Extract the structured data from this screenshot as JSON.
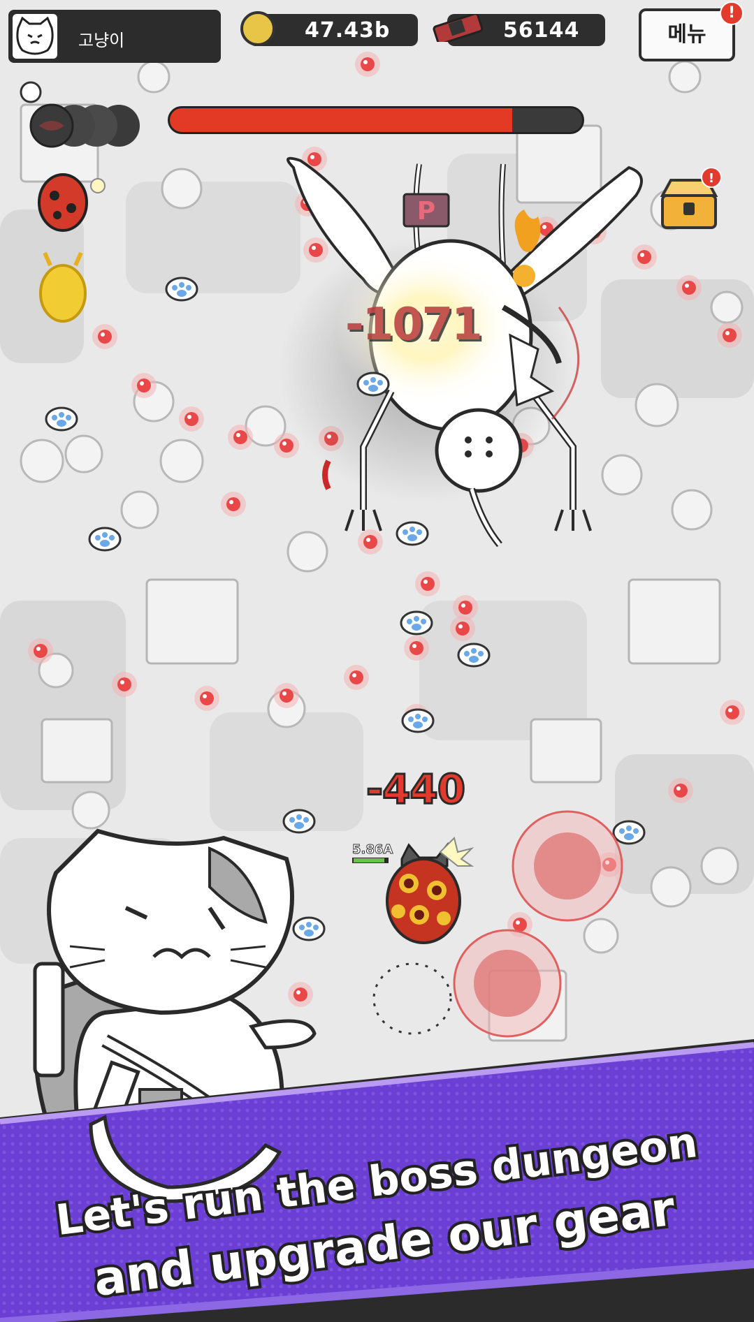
{
  "player": {
    "name": "고냥이"
  },
  "currency": {
    "coins": "47.43b",
    "gems": "56144"
  },
  "menu": {
    "label": "메뉴",
    "badge": "!"
  },
  "boss": {
    "health_fraction": 0.83
  },
  "combat": {
    "damage_large": "-1071",
    "damage_player": "-440",
    "player_power": "5.86A"
  },
  "banner": {
    "line1": "Let's run the boss dungeon",
    "line2": "and upgrade our gear"
  },
  "colors": {
    "hud_dark": "#2e2e2e",
    "boss_hp": "#e33a26",
    "banner_purple": "#6b3fd4",
    "coin": "#e8c547",
    "damage_red": "#e23b2e"
  },
  "icons": {
    "coin": "coin-icon",
    "gem": "dynamite-ticket-icon",
    "chest": "treasure-chest-icon",
    "skills": [
      "fish-skill-icon",
      "ladybug-pet-icon",
      "beetle-pet-icon"
    ]
  }
}
